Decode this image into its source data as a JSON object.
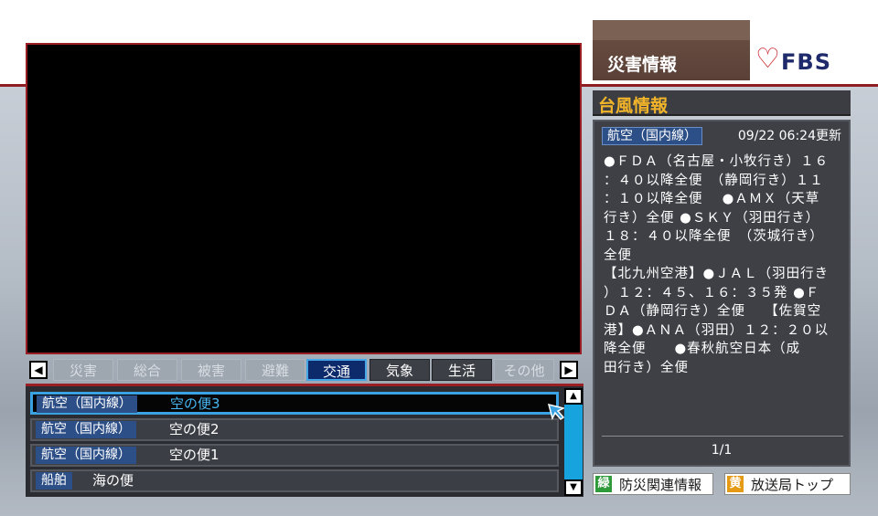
{
  "header": {
    "tab_title": "災害情報",
    "logo_text": "FBS",
    "logo_heart": "♡"
  },
  "categories": {
    "left_arrow": "◀",
    "right_arrow": "▶",
    "items": [
      {
        "label": "災害",
        "state": "disabled"
      },
      {
        "label": "総合",
        "state": "disabled"
      },
      {
        "label": "被害",
        "state": "disabled"
      },
      {
        "label": "避難",
        "state": "disabled"
      },
      {
        "label": "交通",
        "state": "active"
      },
      {
        "label": "気象",
        "state": "enabled"
      },
      {
        "label": "生活",
        "state": "enabled"
      },
      {
        "label": "その他",
        "state": "disabled"
      }
    ]
  },
  "list": {
    "rows": [
      {
        "category": "航空（国内線）",
        "title": "空の便3",
        "selected": true
      },
      {
        "category": "航空（国内線）",
        "title": "空の便2",
        "selected": false
      },
      {
        "category": "航空（国内線）",
        "title": "空の便1",
        "selected": false
      },
      {
        "category": "船舶",
        "title": "海の便",
        "selected": false
      }
    ],
    "scroll_up": "▲",
    "scroll_down": "▼"
  },
  "panel": {
    "header": "台風情報",
    "badge": "航空（国内線）",
    "updated": "09/22 06:24更新",
    "body_lines": [
      "●ＦＤＡ（名古屋・小牧行き）１６",
      "：４０以降全便　（静岡行き）１１",
      "：１０以降全便　 ●ＡＭＸ（天草",
      "行き）全便 ●ＳＫＹ（羽田行き）",
      "１８：４０以降全便　（茨城行き）",
      "全便",
      "【北九州空港】●ＪＡＬ（羽田行き",
      "）１２：４５、１６：３５発 ●Ｆ",
      "ＤＡ（静岡行き）全便　 【佐賀空",
      "港】●ＡＮＡ（羽田）１２：２０以",
      "降全便　　●春秋航空日本（成",
      "田行き）全便"
    ],
    "page": "1/1"
  },
  "buttons": {
    "green_key": "緑",
    "green_label": "防災関連情報",
    "yellow_key": "黄",
    "yellow_label": "放送局トップ"
  },
  "colors": {
    "accent_red": "#9a1f24",
    "active_blue": "#0d2a6b",
    "selection_cyan": "#3aa2e0",
    "panel_header_text": "#f2b52a",
    "green_key": "#2e9a3a",
    "yellow_key": "#e49a14"
  }
}
